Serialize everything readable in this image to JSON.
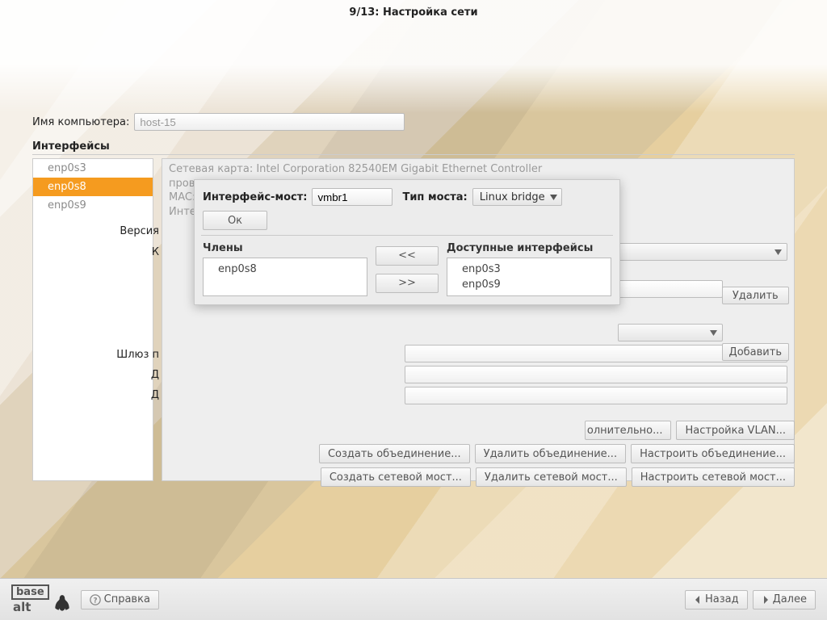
{
  "title": "9/13: Настройка сети",
  "hostname_label": "Имя компьютера:",
  "hostname_placeholder": "host-15",
  "interfaces_header": "Интерфейсы",
  "interfaces": [
    {
      "name": "enp0s3",
      "selected": false
    },
    {
      "name": "enp0s8",
      "selected": true
    },
    {
      "name": "enp0s9",
      "selected": false
    }
  ],
  "info": {
    "line1": "Сетевая карта: Intel Corporation 82540EM Gigabit Ethernet Controller",
    "line2": "провод",
    "line3": "MAC:",
    "line4": "Интер",
    "version_label": "Версия",
    "config_label_initial": "К",
    "gw_label": "Шлюз п",
    "d1": "Д",
    "d2": "Д"
  },
  "right_btns": {
    "delete": "Удалить",
    "add": "Добавить"
  },
  "row_btns": {
    "more": "олнительно...",
    "vlan": "Настройка VLAN...",
    "bond_create": "Создать объединение...",
    "bond_delete": "Удалить объединение...",
    "bond_conf": "Настроить объединение...",
    "br_create": "Создать сетевой мост...",
    "br_delete": "Удалить сетевой мост...",
    "br_conf": "Настроить сетевой мост..."
  },
  "dialog": {
    "iface_label": "Интерфейс-мост:",
    "iface_value": "vmbr1",
    "type_label": "Тип моста:",
    "type_value": "Linux bridge",
    "ok": "Ок",
    "members_title": "Члены",
    "available_title": "Доступные интерфейсы",
    "members": [
      "enp0s8"
    ],
    "available": [
      "enp0s3",
      "enp0s9"
    ],
    "move_left": "<<",
    "move_right": ">>"
  },
  "bottom": {
    "help": "Справка",
    "back": "Назад",
    "next": "Далее",
    "logo_top": "base",
    "logo_bottom": "alt"
  }
}
